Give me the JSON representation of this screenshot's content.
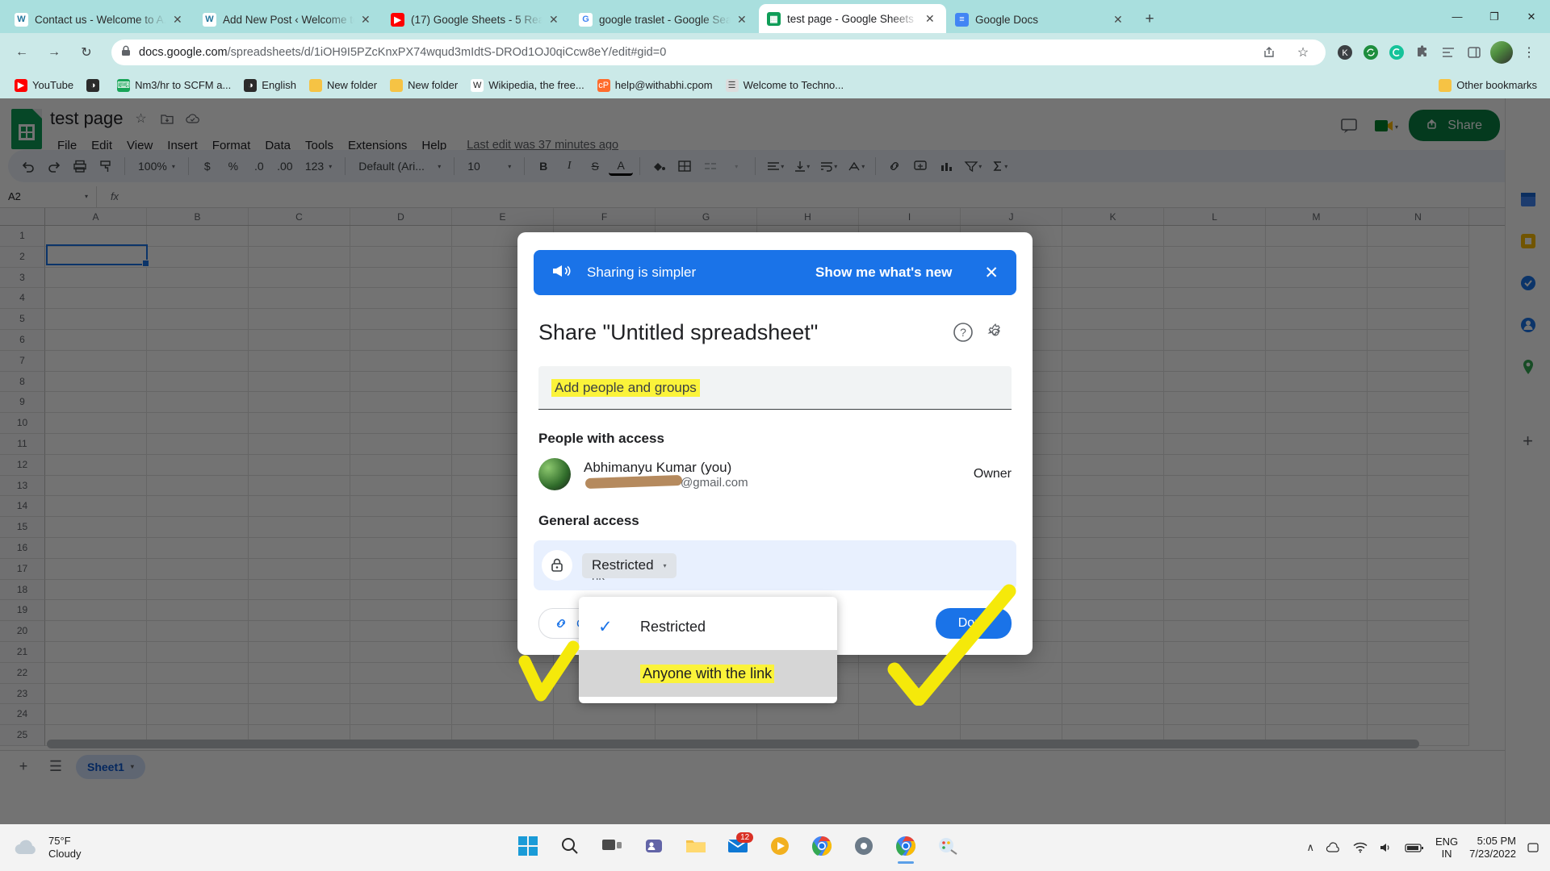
{
  "browser": {
    "tabs": [
      {
        "title": "Contact us - Welcome to A...",
        "favicon": "wordpress-icon",
        "active": false
      },
      {
        "title": "Add New Post ‹ Welcome to...",
        "favicon": "wordpress-icon",
        "active": false
      },
      {
        "title": "(17) Google Sheets - 5 Reas",
        "favicon": "youtube-icon",
        "active": false
      },
      {
        "title": "google traslet - Google Sea",
        "favicon": "google-icon",
        "active": false
      },
      {
        "title": "test page - Google Sheets",
        "favicon": "sheets-icon",
        "active": true
      },
      {
        "title": "Google Docs",
        "favicon": "docs-icon",
        "active": false
      }
    ],
    "new_tab_label": "+",
    "window_controls": {
      "minimize": "—",
      "maximize": "❐",
      "close": "✕"
    },
    "url_host": "docs.google.com",
    "url_path": "/spreadsheets/d/1iOH9I5PZcKnxPX74wqud3mIdtS-DROd1OJ0qiCcw8eY/edit#gid=0",
    "back_label": "←",
    "forward_label": "→",
    "reload_label": "↻",
    "bookmarks": [
      {
        "label": "YouTube",
        "icon": "youtube-icon"
      },
      {
        "label": "",
        "icon": "globe-icon"
      },
      {
        "label": "Nm3/hr to SCFM a...",
        "icon": "calculator-icon"
      },
      {
        "label": "English",
        "icon": "globe-icon"
      },
      {
        "label": "New folder",
        "icon": "folder-icon"
      },
      {
        "label": "New folder",
        "icon": "folder-icon"
      },
      {
        "label": "Wikipedia, the free...",
        "icon": "wikipedia-icon"
      },
      {
        "label": "help@withabhi.cpom",
        "icon": "cpanel-icon"
      },
      {
        "label": "Welcome to Techno...",
        "icon": "page-icon"
      }
    ],
    "other_bookmarks_label": "Other bookmarks"
  },
  "sheets": {
    "doc_title": "test page",
    "title_icons": [
      "star-icon",
      "move-to-folder-icon",
      "cloud-saved-icon"
    ],
    "menus": [
      "File",
      "Edit",
      "View",
      "Insert",
      "Format",
      "Data",
      "Tools",
      "Extensions",
      "Help"
    ],
    "last_edit": "Last edit was 37 minutes ago",
    "share_label": "Share",
    "toolbar": {
      "zoom": "100%",
      "number_format": "123",
      "font": "Default (Ari...",
      "font_size": "10",
      "currency": "$",
      "percent": "%",
      "dec_dec": ".0",
      "inc_dec": ".00",
      "bold": "B",
      "italic": "I",
      "strike": "S",
      "text_color": "A"
    },
    "name_box": "A2",
    "fx_label": "fx",
    "columns": [
      "A",
      "B",
      "C",
      "D",
      "E",
      "F",
      "G",
      "H",
      "I",
      "J",
      "K",
      "L",
      "M",
      "N"
    ],
    "rows": [
      "1",
      "2",
      "3",
      "4",
      "5",
      "6",
      "7",
      "8",
      "9",
      "10",
      "11",
      "12",
      "13",
      "14",
      "15",
      "16",
      "17",
      "18",
      "19",
      "20",
      "21",
      "22",
      "23",
      "24",
      "25"
    ],
    "sheet_tab": "Sheet1",
    "selected_cell": "A2"
  },
  "share_dialog": {
    "promo_text": "Sharing is simpler",
    "promo_link": "Show me what's new",
    "promo_close": "✕",
    "promo_icon": "megaphone-icon",
    "title": "Share \"Untitled spreadsheet\"",
    "help_icon": "help-icon",
    "settings_icon": "gear-icon",
    "add_people_placeholder": "Add people and groups",
    "people_heading": "People with access",
    "person": {
      "name": "Abhimanyu Kumar (you)",
      "email": "@gmail.com",
      "role": "Owner"
    },
    "general_heading": "General access",
    "access_value": "Restricted",
    "access_sub": "nk",
    "copy_link_label": "Copy link",
    "done_label": "Done",
    "dropdown": {
      "items": [
        {
          "label": "Restricted",
          "checked": true,
          "hovered": false,
          "highlighted": false
        },
        {
          "label": "Anyone with the link",
          "checked": false,
          "hovered": true,
          "highlighted": true
        }
      ]
    }
  },
  "taskbar": {
    "weather_temp": "75°F",
    "weather_desc": "Cloudy",
    "apps": [
      {
        "name": "start-button",
        "icon": "windows-icon"
      },
      {
        "name": "search-button",
        "icon": "search-icon"
      },
      {
        "name": "task-view-button",
        "icon": "taskview-icon"
      },
      {
        "name": "teams-button",
        "icon": "teams-icon"
      },
      {
        "name": "file-explorer-button",
        "icon": "folder-icon"
      },
      {
        "name": "mail-button",
        "icon": "mail-icon",
        "badge": "12"
      },
      {
        "name": "media-player-button",
        "icon": "media-icon"
      },
      {
        "name": "chrome-button",
        "icon": "chrome-icon"
      },
      {
        "name": "settings-button",
        "icon": "gear-icon"
      },
      {
        "name": "chrome-active-button",
        "icon": "chrome-icon"
      },
      {
        "name": "paint-button",
        "icon": "paint-icon"
      }
    ],
    "show_hidden": "∧",
    "lang_line1": "ENG",
    "lang_line2": "IN",
    "time": "5:05 PM",
    "date": "7/23/2022"
  },
  "colors": {
    "chrome_theme": "#a9dfde",
    "accent_blue": "#1a73e8",
    "sheets_green": "#0b8043",
    "highlight_yellow": "#fbf33a",
    "marker_yellow": "#f5e90a"
  }
}
